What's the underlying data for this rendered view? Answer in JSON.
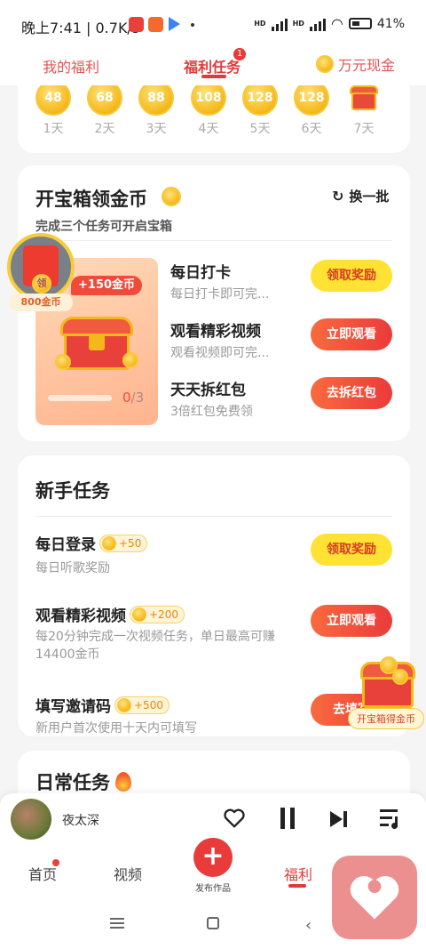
{
  "status_bar": {
    "time": "晚上7:41 | 0.7K/s",
    "battery": "41%",
    "net1": "HD",
    "net2": "HD"
  },
  "tabs": [
    {
      "label": "我的福利"
    },
    {
      "label": "福利任务"
    },
    {
      "label": "万元现金"
    }
  ],
  "tab_badge": "1",
  "checkin": {
    "days": [
      {
        "coins": "48",
        "label": "1天"
      },
      {
        "coins": "68",
        "label": "2天"
      },
      {
        "coins": "88",
        "label": "3天"
      },
      {
        "coins": "108",
        "label": "4天"
      },
      {
        "coins": "128",
        "label": "5天"
      },
      {
        "coins": "128",
        "label": "6天"
      },
      {
        "coins": "",
        "label": "7天"
      }
    ]
  },
  "treasure": {
    "title": "开宝箱领金币",
    "refresh": "换一批",
    "subtitle": "完成三个任务可开启宝箱",
    "bonus": "+150金币",
    "progress": "0",
    "progress_total": "/3",
    "progress_fraction": 0,
    "tasks": [
      {
        "title": "每日打卡",
        "desc": "每日打卡即可完...",
        "button": "领取奖励"
      },
      {
        "title": "观看精彩视频",
        "desc": "观看视频即可完...",
        "button": "立即观看"
      },
      {
        "title": "天天拆红包",
        "desc": "3倍红包免费领",
        "button": "去拆红包"
      }
    ]
  },
  "float_redpacket": {
    "label": "领",
    "amount": "800金币"
  },
  "newbie": {
    "title": "新手任务",
    "tasks": [
      {
        "title": "每日登录",
        "reward": "+50",
        "desc": "每日听歌奖励",
        "button": "领取奖励"
      },
      {
        "title": "观看精彩视频",
        "reward": "+200",
        "desc": "每20分钟完成一次视频任务，单日最高可赚14400金币",
        "button": "立即观看"
      },
      {
        "title": "填写邀请码",
        "reward": "+500",
        "desc": "新用户首次使用十天内可填写",
        "button": "去填写"
      }
    ]
  },
  "float_chest": {
    "label": "开宝箱得金币"
  },
  "daily": {
    "title": "日常任务"
  },
  "player": {
    "song": "夜太深"
  },
  "bottom_nav": {
    "home": "首页",
    "video": "视频",
    "publish": "发布作品",
    "welfare": "福利"
  },
  "colors": {
    "accent": "#e13a3a",
    "yellow_button": "#ffe233",
    "coin": "#f5b81a"
  }
}
